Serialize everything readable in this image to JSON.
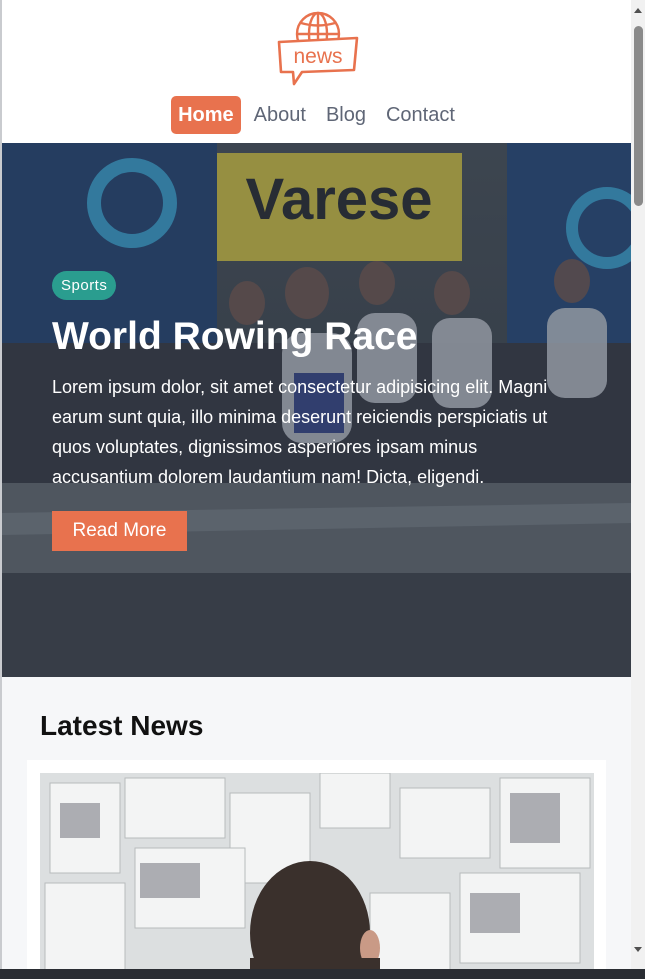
{
  "header": {
    "logo_text": "news",
    "nav": [
      {
        "label": "Home",
        "active": true
      },
      {
        "label": "About",
        "active": false
      },
      {
        "label": "Blog",
        "active": false
      },
      {
        "label": "Contact",
        "active": false
      }
    ]
  },
  "hero": {
    "category": "Sports",
    "title": "World Rowing Race",
    "text": "Lorem ipsum dolor, sit amet consectetur adipisicing elit. Magni earum sunt quia, illo minima deserunt reiciendis perspiciatis ut quos voluptates, dignissimos asperiores ipsam minus accusantium dolorem laudantium nam! Dicta, eligendi.",
    "button": "Read More",
    "banner_text": "Varese"
  },
  "latest": {
    "title": "Latest News"
  },
  "colors": {
    "accent": "#e8724e",
    "badge": "#2a9d8f",
    "nav_text": "#5f6676"
  }
}
